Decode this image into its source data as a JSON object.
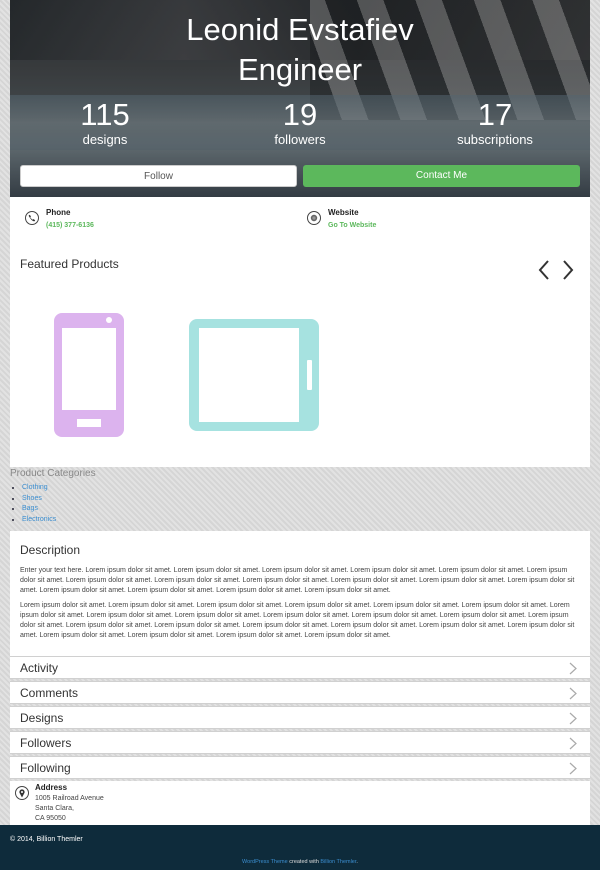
{
  "profile": {
    "name": "Leonid Evstafiev",
    "role": "Engineer",
    "stats": [
      {
        "value": "115",
        "label": "designs"
      },
      {
        "value": "19",
        "label": "followers"
      },
      {
        "value": "17",
        "label": "subscriptions"
      }
    ],
    "follow_label": "Follow",
    "contact_label": "Contact Me",
    "accent_color": "#5cb85c"
  },
  "contact": {
    "phone_title": "Phone",
    "phone_value": "(415) 377-6136",
    "website_title": "Website",
    "website_value": "Go To Website"
  },
  "featured": {
    "title": "Featured Products",
    "items": [
      {
        "icon": "smartphone-icon",
        "color": "#dcb3ee"
      },
      {
        "icon": "tablet-icon",
        "color": "#a6e2e0"
      }
    ]
  },
  "categories": {
    "title": "Product Categories",
    "items": [
      "Clothing",
      "Shoes",
      "Bags",
      "Electronics"
    ]
  },
  "description": {
    "title": "Description",
    "paragraphs": [
      "Enter your text here. Lorem ipsum dolor sit amet. Lorem ipsum dolor sit amet. Lorem ipsum dolor sit amet. Lorem ipsum dolor sit amet. Lorem ipsum dolor sit amet. Lorem ipsum dolor sit amet. Lorem ipsum dolor sit amet. Lorem ipsum dolor sit amet. Lorem ipsum dolor sit amet. Lorem ipsum dolor sit amet. Lorem ipsum dolor sit amet. Lorem ipsum dolor sit amet. Lorem ipsum dolor sit amet. Lorem ipsum dolor sit amet. Lorem ipsum dolor sit amet. Lorem ipsum dolor sit amet.",
      "Lorem ipsum dolor sit amet. Lorem ipsum dolor sit amet. Lorem ipsum dolor sit amet. Lorem ipsum dolor sit amet. Lorem ipsum dolor sit amet. Lorem ipsum dolor sit amet. Lorem ipsum dolor sit amet. Lorem ipsum dolor sit amet. Lorem ipsum dolor sit amet. Lorem ipsum dolor sit amet. Lorem ipsum dolor sit amet. Lorem ipsum dolor sit amet. Lorem ipsum dolor sit amet. Lorem ipsum dolor sit amet. Lorem ipsum dolor sit amet. Lorem ipsum dolor sit amet. Lorem ipsum dolor sit amet. Lorem ipsum dolor sit amet. Lorem ipsum dolor sit amet. Lorem ipsum dolor sit amet. Lorem ipsum dolor sit amet. Lorem ipsum dolor sit amet. Lorem ipsum dolor sit amet."
    ]
  },
  "sections": [
    "Activity",
    "Comments",
    "Designs",
    "Followers",
    "Following"
  ],
  "address": {
    "title": "Address",
    "lines": [
      "1005 Railroad Avenue",
      "Santa Clara,",
      "CA 95050"
    ]
  },
  "footer": {
    "copyright": "© 2014, Billion Themler",
    "credit_link1": "WordPress Theme",
    "credit_mid": " created with ",
    "credit_link2": "Billion Themler",
    "credit_end": "."
  }
}
